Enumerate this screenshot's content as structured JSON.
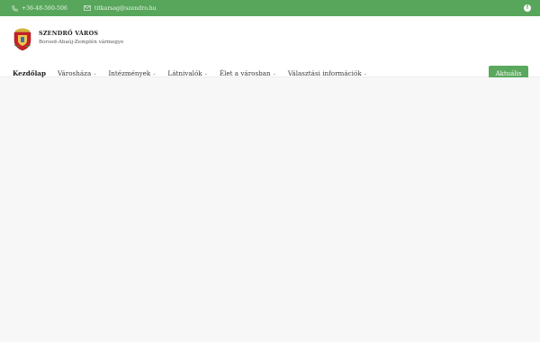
{
  "topbar": {
    "phone": "+36-48-560-506",
    "email": "titkarsag@szendro.hu",
    "social_icon": "facebook-icon"
  },
  "brand": {
    "title": "SZENDRŐ VÁROS",
    "subtitle": "Borsod-Abaúj-Zemplén vármegye",
    "logo_icon": "coat-of-arms-icon"
  },
  "nav": {
    "items": [
      {
        "label": "Kezdőlap",
        "active": true
      },
      {
        "label": "Városháza",
        "dropdown": true
      },
      {
        "label": "Intézmények",
        "dropdown": true
      },
      {
        "label": "Látnivalók",
        "dropdown": true
      },
      {
        "label": "Élet a városban",
        "dropdown": true
      },
      {
        "label": "Választási információk",
        "dropdown": true
      }
    ],
    "cta_label": "Aktuális"
  },
  "colors": {
    "brand_green": "#58a65b",
    "hero_bg": "#f7f7f7"
  }
}
